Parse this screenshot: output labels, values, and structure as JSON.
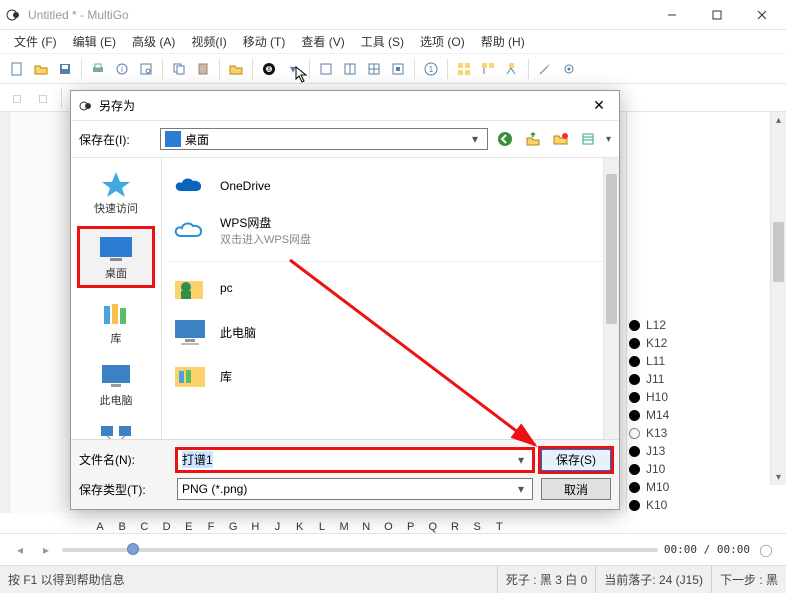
{
  "window": {
    "title": "Untitled  * - MultiGo"
  },
  "menus": {
    "file": "文件 (F)",
    "edit": "编辑 (E)",
    "advanced": "高级 (A)",
    "view_v": "视频(I)",
    "move": "移动 (T)",
    "view": "查看 (V)",
    "tools": "工具 (S)",
    "options": "选项 (O)",
    "help": "帮助 (H)"
  },
  "timebar": {
    "time": "00:00 / 00:00"
  },
  "statusbar": {
    "help": "按 F1 以得到帮助信息",
    "capture": "死子 : 黑 3 白 0",
    "lastmove": "当前落子: 24 (J15)",
    "next": "下一步 : 黑"
  },
  "coords": [
    "A",
    "B",
    "C",
    "D",
    "E",
    "F",
    "G",
    "H",
    "J",
    "K",
    "L",
    "M",
    "N",
    "O",
    "P",
    "Q",
    "R",
    "S",
    "T"
  ],
  "moves": [
    {
      "c": "black",
      "label": "L12"
    },
    {
      "c": "black",
      "label": "K12"
    },
    {
      "c": "black",
      "label": "L11"
    },
    {
      "c": "black",
      "label": "J11"
    },
    {
      "c": "black",
      "label": "H10"
    },
    {
      "c": "black",
      "label": "M14"
    },
    {
      "c": "white",
      "label": "K13"
    },
    {
      "c": "black",
      "label": "J13"
    },
    {
      "c": "black",
      "label": "J10"
    },
    {
      "c": "black",
      "label": "M10"
    },
    {
      "c": "black",
      "label": "K10"
    },
    {
      "c": "alt",
      "label": "J15"
    }
  ],
  "dialog": {
    "title": "另存为",
    "savein_label": "保存在(I):",
    "savein_value": "桌面",
    "places": {
      "quick": "快速访问",
      "desktop": "桌面",
      "lib": "库",
      "thispc": "此电脑",
      "network": "网络"
    },
    "items": {
      "onedrive": "OneDrive",
      "wps": "WPS网盘",
      "wps_sub": "双击进入WPS网盘",
      "pc": "pc",
      "thispc": "此电脑",
      "lib": "库"
    },
    "filename_label": "文件名(N):",
    "filename_value": "打谱1",
    "filetype_label": "保存类型(T):",
    "filetype_value": "PNG (*.png)",
    "save_btn": "保存(S)",
    "cancel_btn": "取消"
  }
}
